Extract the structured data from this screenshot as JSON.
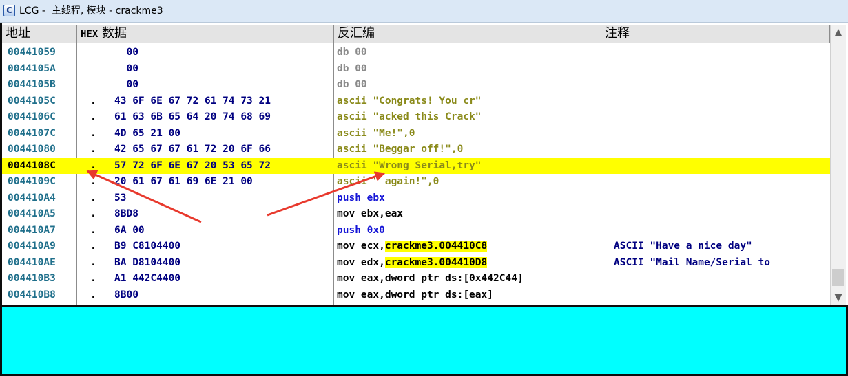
{
  "window": {
    "title": "LCG -  主线程, 模块 - crackme3",
    "icon": "C"
  },
  "columns": {
    "address": "地址",
    "hex_prefix": "HEX",
    "hex_label": " 数据",
    "disasm": "反汇编",
    "comment": "注释"
  },
  "rows": [
    {
      "addr": "00441059",
      "mark": "",
      "hex": "  00",
      "dis": [
        {
          "t": "db 00",
          "c": "db"
        }
      ],
      "cmt": ""
    },
    {
      "addr": "0044105A",
      "mark": "",
      "hex": "  00",
      "dis": [
        {
          "t": "db 00",
          "c": "db"
        }
      ],
      "cmt": ""
    },
    {
      "addr": "0044105B",
      "mark": "",
      "hex": "  00",
      "dis": [
        {
          "t": "db 00",
          "c": "db"
        }
      ],
      "cmt": ""
    },
    {
      "addr": "0044105C",
      "mark": ".",
      "hex": "43 6F 6E 67 72 61 74 73 21",
      "dis": [
        {
          "t": "ascii \"Congrats! You cr\"",
          "c": "ascii"
        }
      ],
      "cmt": ""
    },
    {
      "addr": "0044106C",
      "mark": ".",
      "hex": "61 63 6B 65 64 20 74 68 69",
      "dis": [
        {
          "t": "ascii \"acked this Crack\"",
          "c": "ascii"
        }
      ],
      "cmt": ""
    },
    {
      "addr": "0044107C",
      "mark": ".",
      "hex": "4D 65 21 00",
      "dis": [
        {
          "t": "ascii \"Me!\",0",
          "c": "ascii"
        }
      ],
      "cmt": ""
    },
    {
      "addr": "00441080",
      "mark": ".",
      "hex": "42 65 67 67 61 72 20 6F 66",
      "dis": [
        {
          "t": "ascii \"Beggar off!\",0",
          "c": "ascii"
        }
      ],
      "cmt": ""
    },
    {
      "addr": "0044108C",
      "mark": ".",
      "hex": "57 72 6F 6E 67 20 53 65 72",
      "dis": [
        {
          "t": "ascii \"Wrong Serial,try\"",
          "c": "ascii"
        }
      ],
      "cmt": "",
      "highlight": true
    },
    {
      "addr": "0044109C",
      "mark": ".",
      "hex": "20 61 67 61 69 6E 21 00",
      "dis": [
        {
          "t": "ascii \" again!\",0",
          "c": "ascii"
        }
      ],
      "cmt": ""
    },
    {
      "addr": "004410A4",
      "mark": ".",
      "hex": "53",
      "dis": [
        {
          "t": "push ebx",
          "c": "push"
        }
      ],
      "cmt": ""
    },
    {
      "addr": "004410A5",
      "mark": ".",
      "hex": "8BD8",
      "dis": [
        {
          "t": "mov ebx,eax",
          "c": "mov"
        }
      ],
      "cmt": ""
    },
    {
      "addr": "004410A7",
      "mark": ".",
      "hex": "6A 00",
      "dis": [
        {
          "t": "push 0x0",
          "c": "push"
        }
      ],
      "cmt": ""
    },
    {
      "addr": "004410A9",
      "mark": ".",
      "hex": "B9 C8104400",
      "dis": [
        {
          "t": "mov ecx,",
          "c": "mov"
        },
        {
          "t": "crackme3.004410C8",
          "c": "sym"
        }
      ],
      "cmt": "ASCII \"Have a nice day\""
    },
    {
      "addr": "004410AE",
      "mark": ".",
      "hex": "BA D8104400",
      "dis": [
        {
          "t": "mov edx,",
          "c": "mov"
        },
        {
          "t": "crackme3.004410D8",
          "c": "sym"
        }
      ],
      "cmt": "ASCII \"Mail Name/Serial to"
    },
    {
      "addr": "004410B3",
      "mark": ".",
      "hex": "A1 442C4400",
      "dis": [
        {
          "t": "mov eax,dword ptr ds:[0x442C44]",
          "c": "mov"
        }
      ],
      "cmt": ""
    },
    {
      "addr": "004410B8",
      "mark": ".",
      "hex": "8B00",
      "dis": [
        {
          "t": "mov eax,dword ptr ds:[eax]",
          "c": "mov"
        }
      ],
      "cmt": ""
    }
  ],
  "scrollbar": {
    "up": "▲",
    "down": "▼",
    "position": 0.92
  },
  "colors": {
    "highlight": "#ffff00",
    "bottom_pane": "#00ffff",
    "arrow": "#e8392d"
  }
}
